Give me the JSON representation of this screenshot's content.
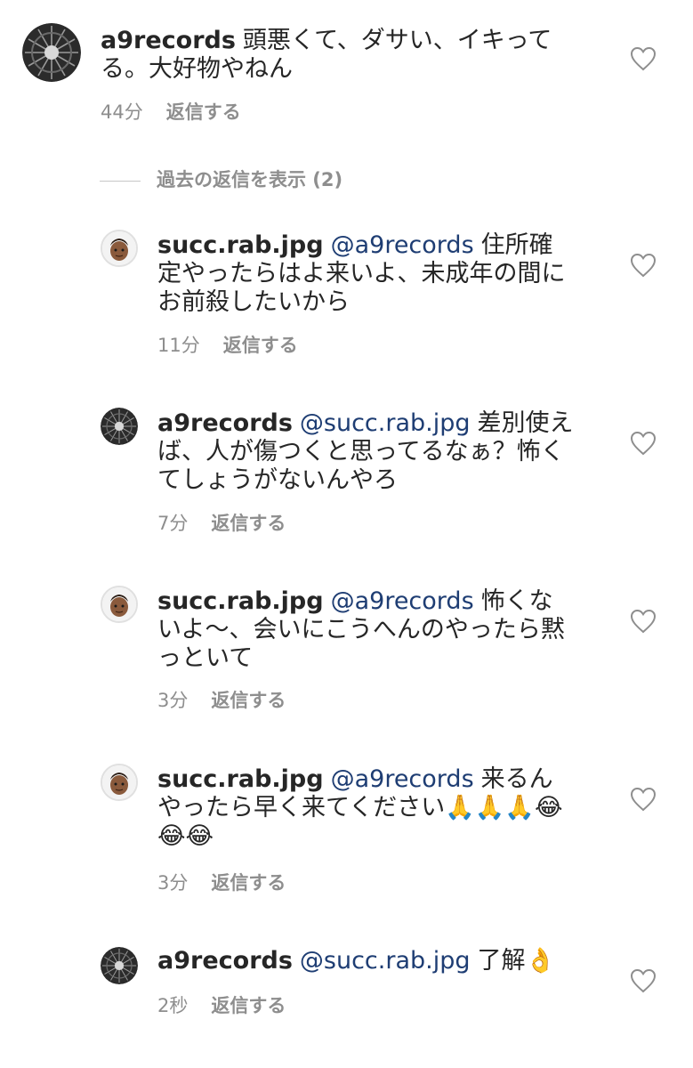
{
  "top_comment": {
    "username": "a9records",
    "text": "頭悪くて、ダサい、イキってる。大好物やねん",
    "time": "44分",
    "reply_label": "返信する"
  },
  "view_replies_label": "過去の返信を表示 (2)",
  "replies": [
    {
      "username": "succ.rab.jpg",
      "mention": "@a9records",
      "text": "住所確定やったらはよ来いよ、未成年の間にお前殺したいから",
      "time": "11分",
      "reply_label": "返信する"
    },
    {
      "username": "a9records",
      "mention": "@succ.rab.jpg",
      "text": "差別使えば、人が傷つくと思ってるなぁ？怖くてしょうがないんやろ",
      "time": "7分",
      "reply_label": "返信する"
    },
    {
      "username": "succ.rab.jpg",
      "mention": "@a9records",
      "text": "怖くないよ〜、会いにこうへんのやったら黙っといて",
      "time": "3分",
      "reply_label": "返信する"
    },
    {
      "username": "succ.rab.jpg",
      "mention": "@a9records",
      "text": "来るんやったら早く来てください🙏🙏🙏😂😂😂",
      "time": "3分",
      "reply_label": "返信する"
    },
    {
      "username": "a9records",
      "mention": "@succ.rab.jpg",
      "text": "了解👌",
      "time": "2秒",
      "reply_label": "返信する"
    }
  ],
  "icons": {
    "heart": "heart-outline-icon",
    "avatar_a9": "turbine-avatar",
    "avatar_succ": "memoji-avatar"
  },
  "colors": {
    "text": "#262626",
    "meta": "#8e8e8e",
    "mention": "#1e3d73"
  }
}
